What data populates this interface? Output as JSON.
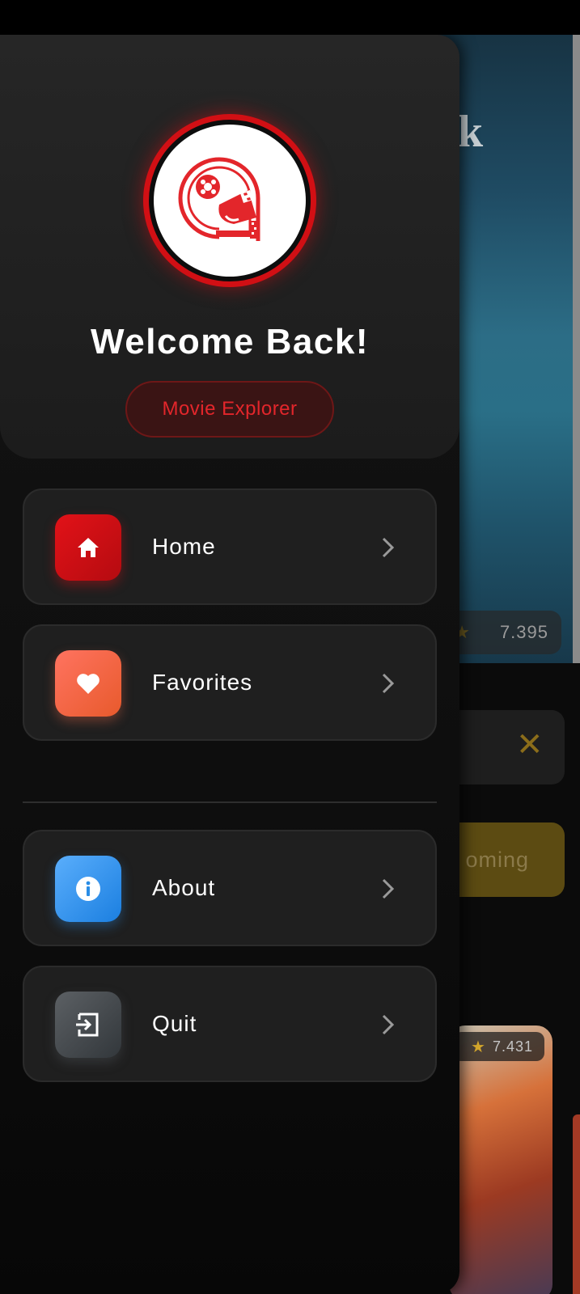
{
  "header": {
    "welcome_text": "Welcome Back!",
    "tagline": "Movie Explorer",
    "accent_color": "#d10f14"
  },
  "menu": {
    "primary": [
      {
        "label": "Home",
        "icon": "home-icon",
        "color": "#d10f14"
      },
      {
        "label": "Favorites",
        "icon": "heart-icon",
        "color": "#f06a4a"
      }
    ],
    "secondary": [
      {
        "label": "About",
        "icon": "info-icon",
        "color": "#2a8de6"
      },
      {
        "label": "Quit",
        "icon": "logout-icon",
        "color": "#5a5f63"
      }
    ]
  },
  "background": {
    "hero_title_fragment": "k",
    "hero_rating": "7.395",
    "chip_label_fragment": "oming",
    "card_rating": "7.431"
  }
}
